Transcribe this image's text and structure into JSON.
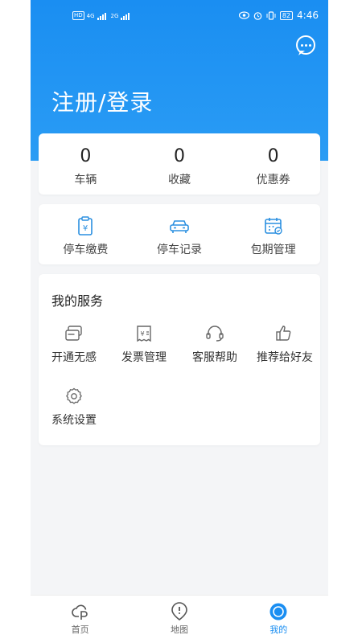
{
  "status_bar": {
    "network_badge": "HD",
    "signal_1": "4G",
    "signal_2": "2G",
    "battery": "82",
    "time": "4:46"
  },
  "header": {
    "title": "注册/登录",
    "chat_icon": "chat-bubble-icon"
  },
  "stats": [
    {
      "value": "0",
      "label": "车辆"
    },
    {
      "value": "0",
      "label": "收藏"
    },
    {
      "value": "0",
      "label": "优惠券"
    }
  ],
  "quick_actions": [
    {
      "label": "停车缴费",
      "icon": "payment-icon"
    },
    {
      "label": "停车记录",
      "icon": "car-icon"
    },
    {
      "label": "包期管理",
      "icon": "calendar-icon"
    }
  ],
  "services": {
    "title": "我的服务",
    "items": [
      {
        "label": "开通无感",
        "icon": "card-icon"
      },
      {
        "label": "发票管理",
        "icon": "invoice-icon"
      },
      {
        "label": "客服帮助",
        "icon": "headset-icon"
      },
      {
        "label": "推荐给好友",
        "icon": "thumbs-up-icon"
      },
      {
        "label": "系统设置",
        "icon": "gear-icon"
      }
    ]
  },
  "tabbar": [
    {
      "label": "首页",
      "icon": "home-icon",
      "active": false
    },
    {
      "label": "地图",
      "icon": "map-pin-icon",
      "active": false
    },
    {
      "label": "我的",
      "icon": "profile-icon",
      "active": true
    }
  ],
  "colors": {
    "primary": "#1a8ef2",
    "icon_blue": "#2a8fe0",
    "icon_gray": "#666666"
  }
}
